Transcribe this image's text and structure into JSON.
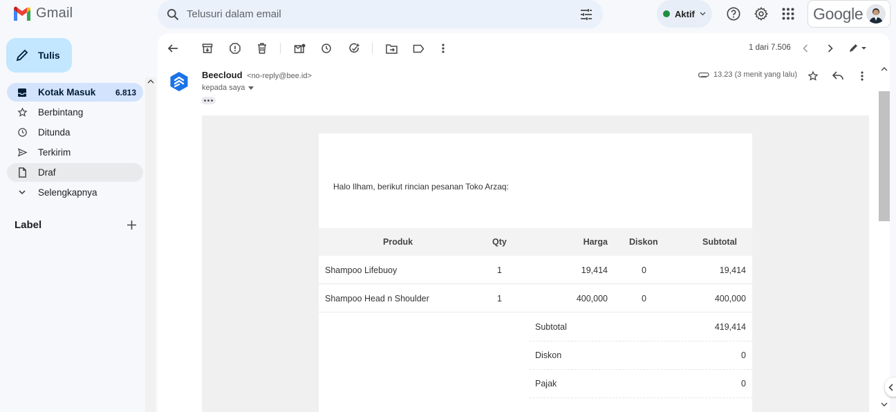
{
  "app": {
    "name": "Gmail"
  },
  "search": {
    "placeholder": "Telusuri dalam email"
  },
  "status": {
    "label": "Aktif",
    "color": "#1e8e3e"
  },
  "header_icons": [
    "help-icon",
    "settings-icon",
    "apps-icon"
  ],
  "account": {
    "brand": "Google"
  },
  "compose": {
    "label": "Tulis"
  },
  "sidebar": {
    "items": [
      {
        "label": "Kotak Masuk",
        "count": "6.813",
        "icon": "inbox-icon",
        "active": true
      },
      {
        "label": "Berbintang",
        "icon": "star-icon"
      },
      {
        "label": "Ditunda",
        "icon": "clock-icon"
      },
      {
        "label": "Terkirim",
        "icon": "send-icon"
      },
      {
        "label": "Draf",
        "icon": "draft-icon"
      },
      {
        "label": "Selengkapnya",
        "icon": "chevron-down-icon"
      }
    ],
    "labels_heading": "Label"
  },
  "toolbar": {
    "pager": "1 dari 7.506"
  },
  "message": {
    "sender_name": "Beecloud",
    "sender_email": "<no-reply@bee.id>",
    "to": "kepada saya",
    "time": "13.23 (3 menit yang lalu)"
  },
  "email": {
    "greeting": "Halo Ilham, berikut rincian pesanan Toko Arzaq:",
    "columns": [
      "Produk",
      "Qty",
      "Harga",
      "Diskon",
      "Subtotal"
    ],
    "rows": [
      {
        "product": "Shampoo Lifebuoy",
        "qty": "1",
        "price": "19,414",
        "discount": "0",
        "subtotal": "19,414"
      },
      {
        "product": "Shampoo Head n Shoulder",
        "qty": "1",
        "price": "400,000",
        "discount": "0",
        "subtotal": "400,000"
      }
    ],
    "summary": [
      {
        "label": "Subtotal",
        "value": "419,414"
      },
      {
        "label": "Diskon",
        "value": "0"
      },
      {
        "label": "Pajak",
        "value": "0"
      }
    ]
  },
  "colors": {
    "accent": "#c2e7ff",
    "active_nav": "#d3e3fd",
    "bg": "#f6f8fc",
    "beecloud": "#1a73e8"
  }
}
